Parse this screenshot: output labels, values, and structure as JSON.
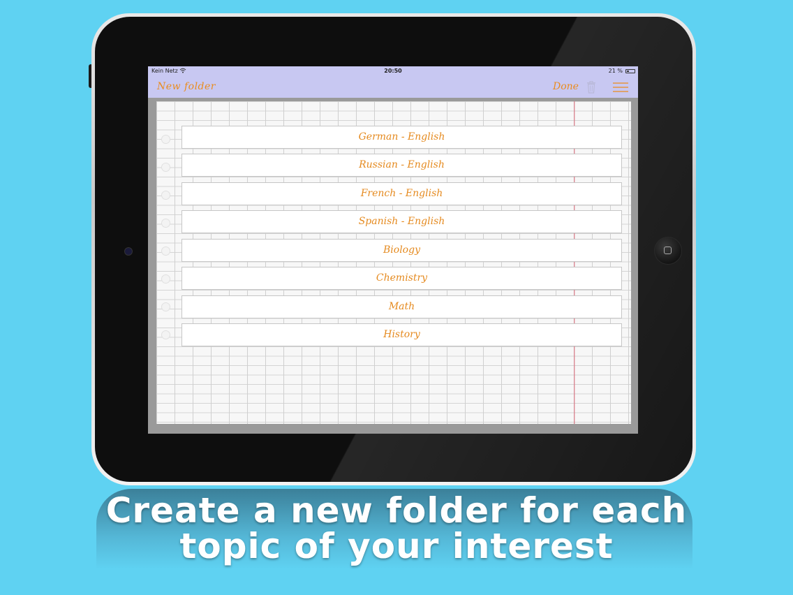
{
  "status_bar": {
    "carrier": "Kein Netz",
    "time": "20:50",
    "battery": "21 %"
  },
  "nav_bar": {
    "new_folder_label": "New folder",
    "done_label": "Done"
  },
  "folders": [
    {
      "label": "German - English"
    },
    {
      "label": "Russian - English"
    },
    {
      "label": "French - English"
    },
    {
      "label": "Spanish - English"
    },
    {
      "label": "Biology"
    },
    {
      "label": "Chemistry"
    },
    {
      "label": "Math"
    },
    {
      "label": "History"
    }
  ],
  "caption": {
    "line1": "Create a new folder for each",
    "line2": "topic of your interest"
  },
  "colors": {
    "background": "#5fd2f2",
    "accent": "#ea8c1e",
    "bar": "#c8c8f2"
  },
  "icons": {
    "wifi": "wifi-icon",
    "battery": "battery-icon",
    "trash": "trash-icon",
    "menu": "menu-icon"
  }
}
